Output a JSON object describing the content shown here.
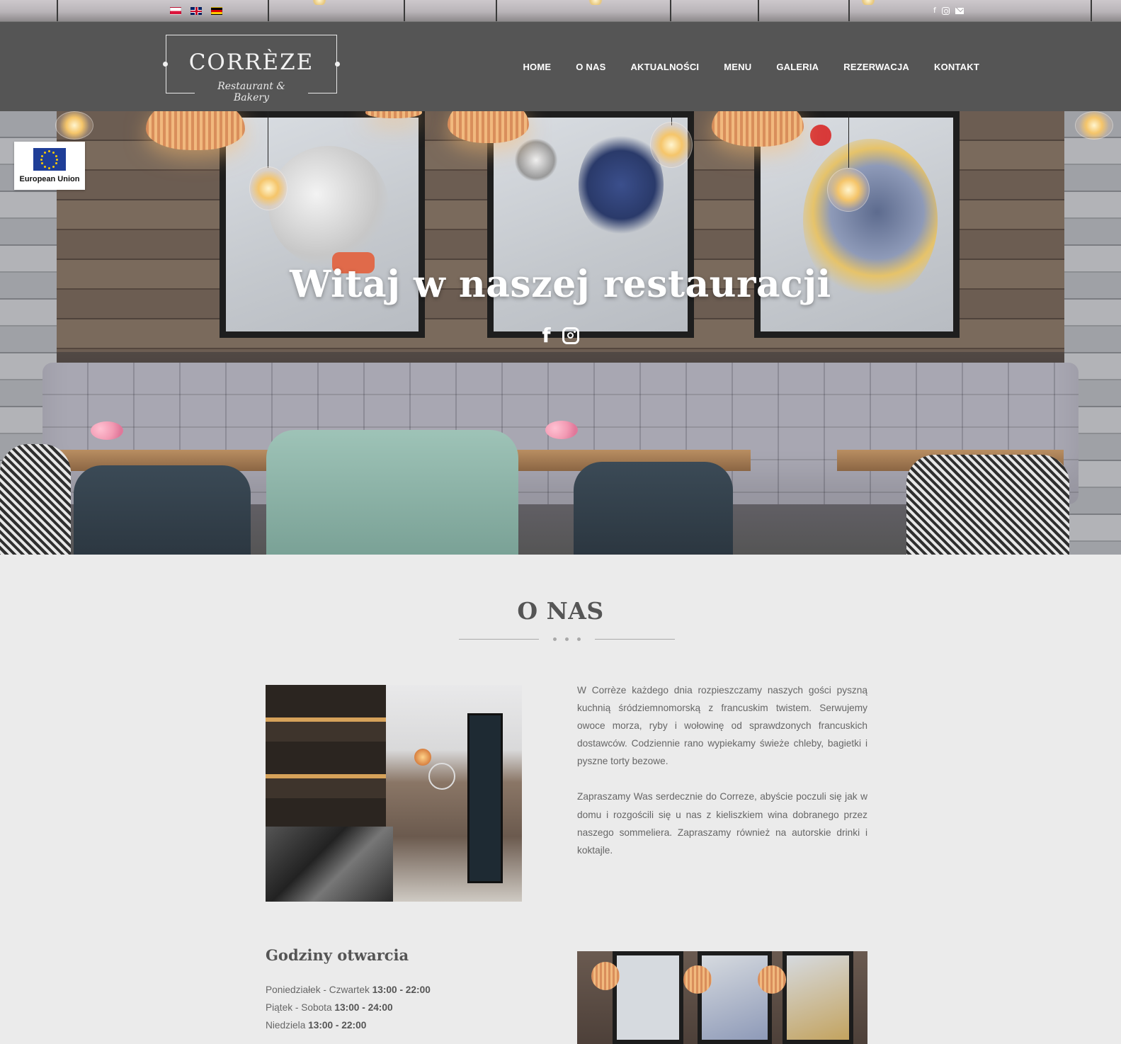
{
  "topbar": {
    "flags": [
      {
        "icon": "flag-pl-icon",
        "lang": "pl"
      },
      {
        "icon": "flag-en-icon",
        "lang": "en"
      },
      {
        "icon": "flag-de-icon",
        "lang": "de"
      }
    ],
    "social_icons": [
      "facebook-icon",
      "instagram-icon",
      "mail-icon"
    ],
    "facebook_glyph": "f"
  },
  "header": {
    "logo_name": "CORRÈZE",
    "logo_tagline": "Restaurant & Bakery",
    "nav": [
      "HOME",
      "O NAS",
      "AKTUALNOŚCI",
      "MENU",
      "GALERIA",
      "REZERWACJA",
      "KONTAKT"
    ],
    "background_color": "#555555"
  },
  "hero": {
    "title": "Witaj w naszej restauracji",
    "social_icons": [
      "facebook-icon",
      "instagram-icon"
    ],
    "facebook_glyph": "f",
    "badge": {
      "label": "European Union",
      "icon": "eu-flag-icon"
    }
  },
  "about": {
    "title": "O NAS",
    "paragraphs": [
      "W Corrèze każdego dnia rozpieszczamy naszych gości pyszną kuchnią śródziemnomorską z francuskim twistem. Serwujemy owoce morza, ryby i wołowinę od sprawdzonych francuskich dostawców. Codziennie rano wypiekamy świeże chleby, bagietki i pyszne torty bezowe.",
      "Zapraszamy Was serdecznie do Correze, abyście poczuli się jak w domu i rozgościli się u nas z kieliszkiem wina dobranego przez naszego sommeliera. Zapraszamy również na autorskie drinki i koktajle."
    ],
    "hours_title": "Godziny otwarcia",
    "hours": [
      {
        "days": "Poniedziałek - Czwartek",
        "time": "13:00 - 22:00"
      },
      {
        "days": "Piątek - Sobota",
        "time": "13:00 - 24:00"
      },
      {
        "days": "Niedziela",
        "time": "13:00 - 22:00"
      }
    ]
  },
  "colors": {
    "page_background": "#ebebeb",
    "text": "#666666",
    "accent_heading": "#555555"
  }
}
